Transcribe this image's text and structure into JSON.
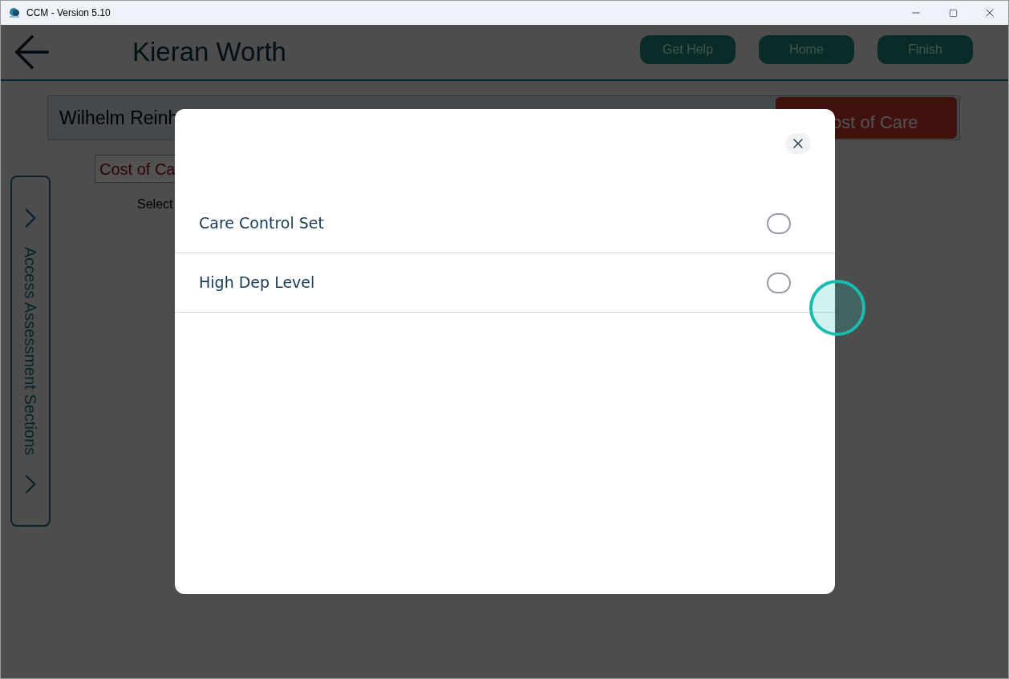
{
  "window": {
    "title": "CCM - Version 5.10"
  },
  "header": {
    "title": "Kieran Worth",
    "buttons": [
      "Get Help",
      "Home",
      "Finish"
    ]
  },
  "patient_bar": {
    "name": "Wilhelm Reinh",
    "action": "ost of Care"
  },
  "section_field": {
    "value": "Cost of Ca"
  },
  "select_label": "Select",
  "side_tab": {
    "label": "Access Assessment Sections"
  },
  "dialog": {
    "options": [
      {
        "label": "Care Control Set",
        "selected": false
      },
      {
        "label": "High Dep Level",
        "selected": false
      }
    ]
  }
}
